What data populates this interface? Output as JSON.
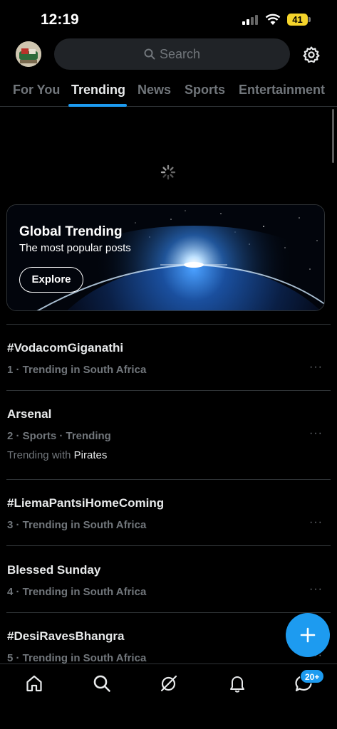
{
  "status_bar": {
    "time": "12:19",
    "battery": "41"
  },
  "search": {
    "placeholder": "Search"
  },
  "tabs": [
    {
      "label": "For You"
    },
    {
      "label": "Trending"
    },
    {
      "label": "News"
    },
    {
      "label": "Sports"
    },
    {
      "label": "Entertainment"
    }
  ],
  "active_tab": "Trending",
  "banner": {
    "title": "Global Trending",
    "subtitle": "The most popular posts",
    "button": "Explore"
  },
  "trends": [
    {
      "title": "#VodacomGiganathi",
      "meta": "1 · Trending in South Africa"
    },
    {
      "title": "Arsenal",
      "meta": "2 · Sports · Trending",
      "with_prefix": "Trending with",
      "with_name": "Pirates"
    },
    {
      "title": "#LiemaPantsiHomeComing",
      "meta": "3 · Trending in South Africa"
    },
    {
      "title": "Blessed Sunday",
      "meta": "4 · Trending in South Africa"
    },
    {
      "title": "#DesiRavesBhangra",
      "meta": "5 · Trending in South Africa"
    }
  ],
  "more_glyph": "···",
  "nav_badge": "20+",
  "icons": [
    "home-icon",
    "search-icon",
    "grok-icon",
    "bell-icon",
    "messages-icon",
    "plus-icon",
    "gear-icon"
  ],
  "colors": {
    "accent": "#1d9bf0",
    "background": "#000000",
    "muted": "#71767b",
    "battery": "#f5d42b"
  }
}
